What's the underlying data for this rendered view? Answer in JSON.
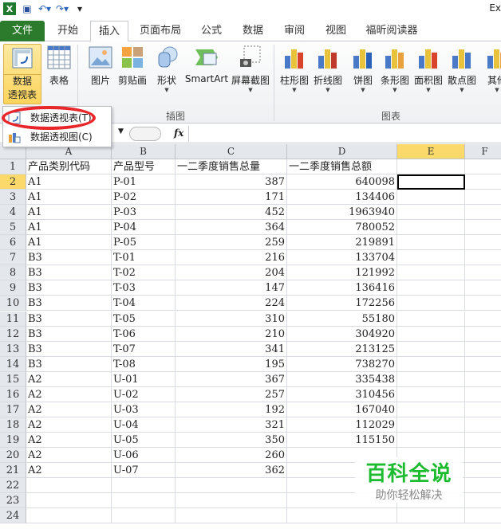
{
  "app_title": "Ex",
  "tabs": [
    "文件",
    "开始",
    "插入",
    "页面布局",
    "公式",
    "数据",
    "审阅",
    "视图",
    "福昕阅读器"
  ],
  "ribbon": {
    "pivot_line1": "数据",
    "pivot_line2": "透视表",
    "table": "表格",
    "picture": "图片",
    "clipart": "剪贴画",
    "shapes": "形状",
    "smartart": "SmartArt",
    "screenshot": "屏幕截图",
    "charts": [
      "柱形图",
      "折线图",
      "饼图",
      "条形图",
      "面积图",
      "散点图",
      "其他"
    ],
    "group_illustrations": "插图",
    "group_charts": "图表"
  },
  "menu": {
    "pivot_table": "数据透视表(T)",
    "pivot_chart": "数据透视图(C)"
  },
  "formula": {
    "fx": "fx",
    "value": ""
  },
  "columns": [
    "A",
    "B",
    "C",
    "D",
    "E",
    "F"
  ],
  "headers": [
    "产品类别代码",
    "产品型号",
    "一二季度销售总量",
    "一二季度销售总额"
  ],
  "rows": [
    [
      "A1",
      "P-01",
      "387",
      "640098"
    ],
    [
      "A1",
      "P-02",
      "171",
      "134406"
    ],
    [
      "A1",
      "P-03",
      "452",
      "1963940"
    ],
    [
      "A1",
      "P-04",
      "364",
      "780052"
    ],
    [
      "A1",
      "P-05",
      "259",
      "219891"
    ],
    [
      "B3",
      "T-01",
      "216",
      "133704"
    ],
    [
      "B3",
      "T-02",
      "204",
      "121992"
    ],
    [
      "B3",
      "T-03",
      "147",
      "136416"
    ],
    [
      "B3",
      "T-04",
      "224",
      "172256"
    ],
    [
      "B3",
      "T-05",
      "310",
      "55180"
    ],
    [
      "B3",
      "T-06",
      "210",
      "304920"
    ],
    [
      "B3",
      "T-07",
      "341",
      "213125"
    ],
    [
      "B3",
      "T-08",
      "195",
      "738270"
    ],
    [
      "A2",
      "U-01",
      "367",
      "335438"
    ],
    [
      "A2",
      "U-02",
      "257",
      "310456"
    ],
    [
      "A2",
      "U-03",
      "192",
      "167040"
    ],
    [
      "A2",
      "U-04",
      "321",
      "112029"
    ],
    [
      "A2",
      "U-05",
      "350",
      "115150"
    ],
    [
      "A2",
      "U-06",
      "260",
      ""
    ],
    [
      "A2",
      "U-07",
      "362",
      ""
    ]
  ],
  "extra_rows": [
    "22",
    "23",
    "24"
  ],
  "watermark": {
    "title": "百科全说",
    "subtitle": "助你轻松解决"
  }
}
